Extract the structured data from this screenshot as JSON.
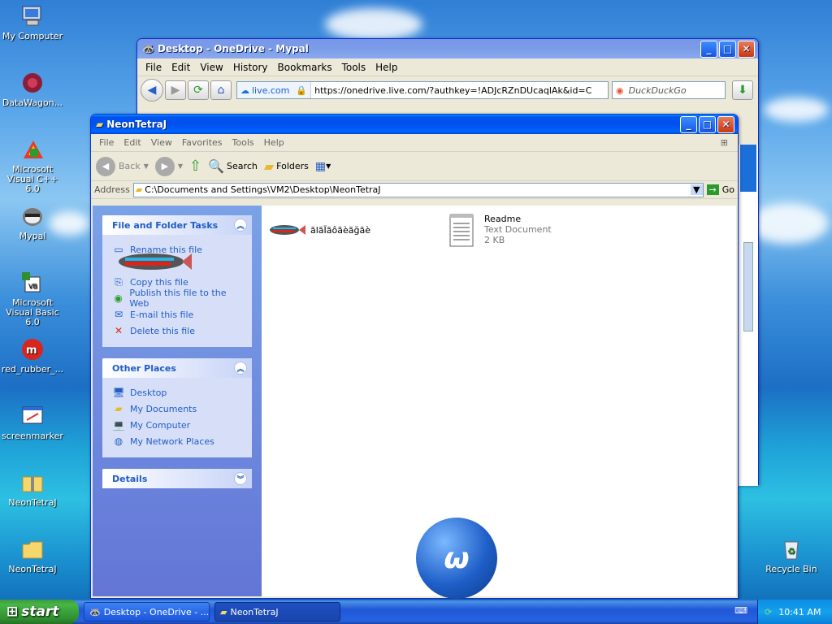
{
  "desktop": {
    "icons": [
      {
        "label": "My Computer",
        "icon": "computer-icon"
      },
      {
        "label": "DataWagon...",
        "icon": "datawagon-icon"
      },
      {
        "label": "Microsoft Visual C++ 6.0",
        "icon": "visual-cpp-icon"
      },
      {
        "label": "Mypal",
        "icon": "mypal-browser-icon"
      },
      {
        "label": "Microsoft Visual Basic 6.0",
        "icon": "visual-basic-icon"
      },
      {
        "label": "red_rubber_...",
        "icon": "red-rubber-icon"
      },
      {
        "label": "screenmarker",
        "icon": "screenmarker-icon"
      },
      {
        "label": "NeonTetraJ",
        "icon": "zip-folder-icon"
      },
      {
        "label": "NeonTetraJ",
        "icon": "folder-icon"
      },
      {
        "label": "Recycle Bin",
        "icon": "recycle-bin-icon"
      }
    ]
  },
  "browser": {
    "title": "Desktop - OneDrive - Mypal",
    "menu": [
      "File",
      "Edit",
      "View",
      "History",
      "Bookmarks",
      "Tools",
      "Help"
    ],
    "site_badge": "live.com",
    "url": "https://onedrive.live.com/?authkey=!ADJcRZnDUcaqlAk&id=C",
    "search_placeholder": "DuckDuckGo"
  },
  "explorer": {
    "title": "NeonTetraJ",
    "menu": [
      "File",
      "Edit",
      "View",
      "Favorites",
      "Tools",
      "Help"
    ],
    "toolbar": {
      "back": "Back",
      "search": "Search",
      "folders": "Folders"
    },
    "address_label": "Address",
    "address_path": "C:\\Documents and Settings\\VM2\\Desktop\\NeonTetraJ",
    "go_label": "Go",
    "file_tasks": {
      "header": "File and Folder Tasks",
      "items": [
        "Rename this file",
        "Copy this file",
        "Publish this file to the Web",
        "E-mail this file",
        "Delete this file"
      ]
    },
    "other_places": {
      "header": "Other Places",
      "items": [
        "Desktop",
        "My Documents",
        "My Computer",
        "My Network Places"
      ]
    },
    "details": {
      "header": "Details"
    },
    "files": [
      {
        "name": "ãlãÏãôãèãğãè",
        "type": "",
        "size": ""
      },
      {
        "name": "Readme",
        "type": "Text Document",
        "size": "2 KB"
      }
    ]
  },
  "taskbar": {
    "start": "start",
    "tasks": [
      "Desktop - OneDrive - ...",
      "NeonTetraJ"
    ],
    "clock": "10:41 AM"
  },
  "colors": {
    "xp_blue": "#0053ee",
    "panel_link": "#215dc6",
    "taskbar": "#2157d7"
  }
}
